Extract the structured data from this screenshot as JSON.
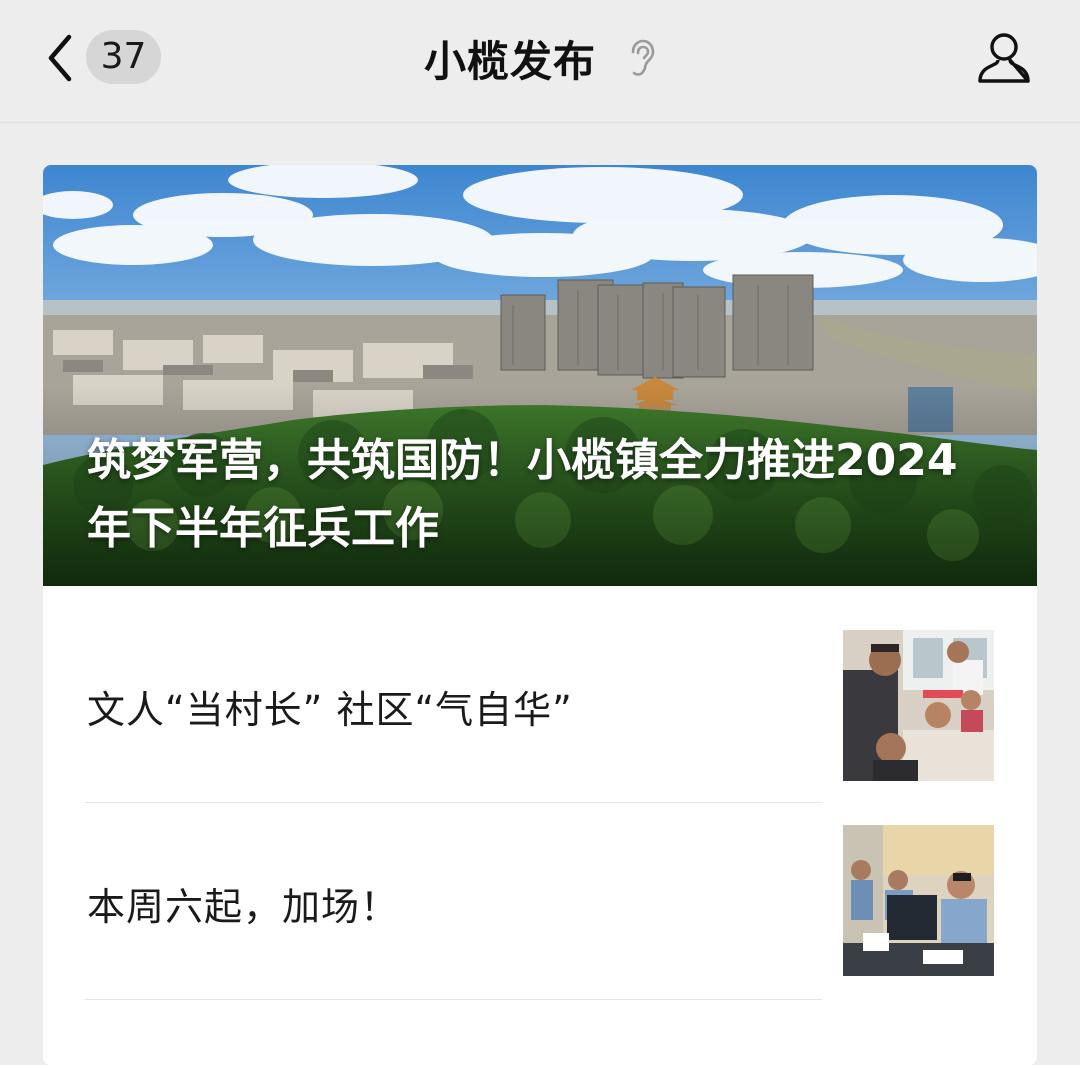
{
  "header": {
    "unread_count": "37",
    "title": "小榄发布",
    "icons": {
      "back": "chevron-left-icon",
      "listen": "ear-icon",
      "profile": "user-icon"
    }
  },
  "featured": {
    "title": "筑梦军营，共筑国防！小榄镇全力推进2024年下半年征兵工作",
    "image": "city-skyline-river-aerial-photo"
  },
  "articles": [
    {
      "title": "文人“当村长” 社区“气自华”",
      "thumbnail": "classroom-children-photo"
    },
    {
      "title": "本周六起，加场！",
      "thumbnail": "service-counter-staff-photo"
    }
  ],
  "colors": {
    "page_bg": "#ededed",
    "card_bg": "#ffffff",
    "badge_bg": "#d6d6d6",
    "text": "#1a1a1a"
  }
}
